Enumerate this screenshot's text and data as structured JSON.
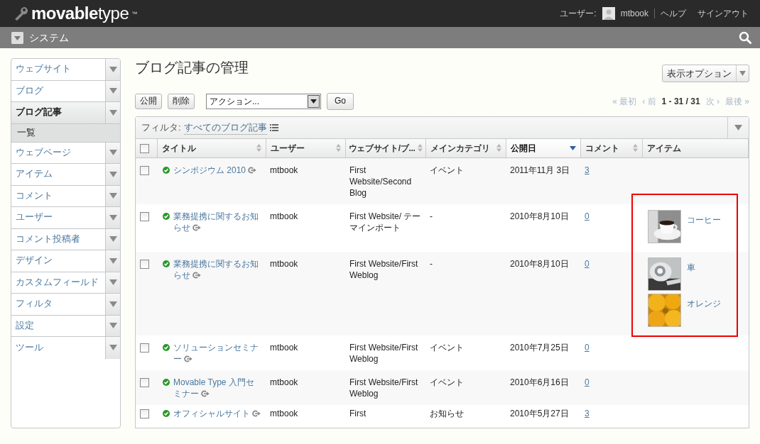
{
  "header": {
    "logo": "**movable**type",
    "trademark": "™",
    "user_label": "ユーザー:",
    "user_name": "mtbook",
    "links": [
      "ヘルプ",
      "サインアウト"
    ]
  },
  "scope_bar": {
    "label": "システム"
  },
  "sidebar": {
    "items": [
      {
        "label": "ウェブサイト",
        "selected": false
      },
      {
        "label": "ブログ",
        "selected": false
      },
      {
        "label": "ブログ記事",
        "selected": true,
        "children": [
          {
            "label": "一覧",
            "selected": true
          }
        ]
      },
      {
        "label": "ウェブページ",
        "selected": false
      },
      {
        "label": "アイテム",
        "selected": false
      },
      {
        "label": "コメント",
        "selected": false
      },
      {
        "label": "ユーザー",
        "selected": false
      },
      {
        "label": "コメント投稿者",
        "selected": false
      },
      {
        "label": "デザイン",
        "selected": false
      },
      {
        "label": "カスタムフィールド",
        "selected": false
      },
      {
        "label": "フィルタ",
        "selected": false
      },
      {
        "label": "設定",
        "selected": false
      },
      {
        "label": "ツール",
        "selected": false
      }
    ]
  },
  "page_title": "ブログ記事の管理",
  "display_options": "表示オプション",
  "actions": {
    "buttons": [
      "公開",
      "削除"
    ],
    "select": "アクション...",
    "go": "Go"
  },
  "pagination": {
    "first": "« 最初",
    "prev": "‹ 前",
    "range": "1 - 31 / 31",
    "next": "次 ›",
    "last": "最後 »"
  },
  "filter": {
    "label": "フィルタ:",
    "value": "すべてのブログ記事"
  },
  "table": {
    "select_all_checked": false,
    "columns": [
      {
        "label": "タイトル",
        "sorted": false
      },
      {
        "label": "ユーザー",
        "sorted": false
      },
      {
        "label": "ウェブサイト/ブ...",
        "sorted": false
      },
      {
        "label": "メインカテゴリ",
        "sorted": false
      },
      {
        "label": "公開日",
        "sorted": true
      },
      {
        "label": "コメント",
        "sorted": false
      },
      {
        "label": "アイテム",
        "sorted": false
      }
    ],
    "rows": [
      {
        "checked": false,
        "published": true,
        "title": "シンポジウム 2010",
        "user": "mtbook",
        "site": "First Website/Second Blog",
        "category": "イベント",
        "date": "2011年11月 3日",
        "comments": "3",
        "items": []
      },
      {
        "checked": false,
        "published": true,
        "title": "業務提携に関するお知らせ",
        "user": "mtbook",
        "site": "First Website/ テーマインポート",
        "category": "-",
        "date": "2010年8月10日",
        "comments": "0",
        "items": [
          {
            "label": "コーヒー",
            "kind": "picture"
          }
        ]
      },
      {
        "checked": false,
        "published": true,
        "title": "業務提携に関するお知らせ",
        "user": "mtbook",
        "site": "First Website/First Weblog",
        "category": "-",
        "date": "2010年8月10日",
        "comments": "0",
        "items": [
          {
            "label": "車",
            "kind": "picture"
          },
          {
            "label": "オレンジ",
            "kind": "picture"
          }
        ]
      },
      {
        "checked": false,
        "published": true,
        "title": "ソリューションセミナー",
        "user": "mtbook",
        "site": "First Website/First Weblog",
        "category": "イベント",
        "date": "2010年7月25日",
        "comments": "0",
        "items": []
      },
      {
        "checked": false,
        "published": true,
        "title": "Movable Type 入門セミナー",
        "user": "mtbook",
        "site": "First Website/First Weblog",
        "category": "イベント",
        "date": "2010年6月16日",
        "comments": "0",
        "items": []
      },
      {
        "checked": false,
        "published": true,
        "title": "オフィシャルサイト",
        "user": "mtbook",
        "site": "First",
        "category": "お知らせ",
        "date": "2010年5月27日",
        "comments": "3",
        "items": []
      }
    ]
  }
}
